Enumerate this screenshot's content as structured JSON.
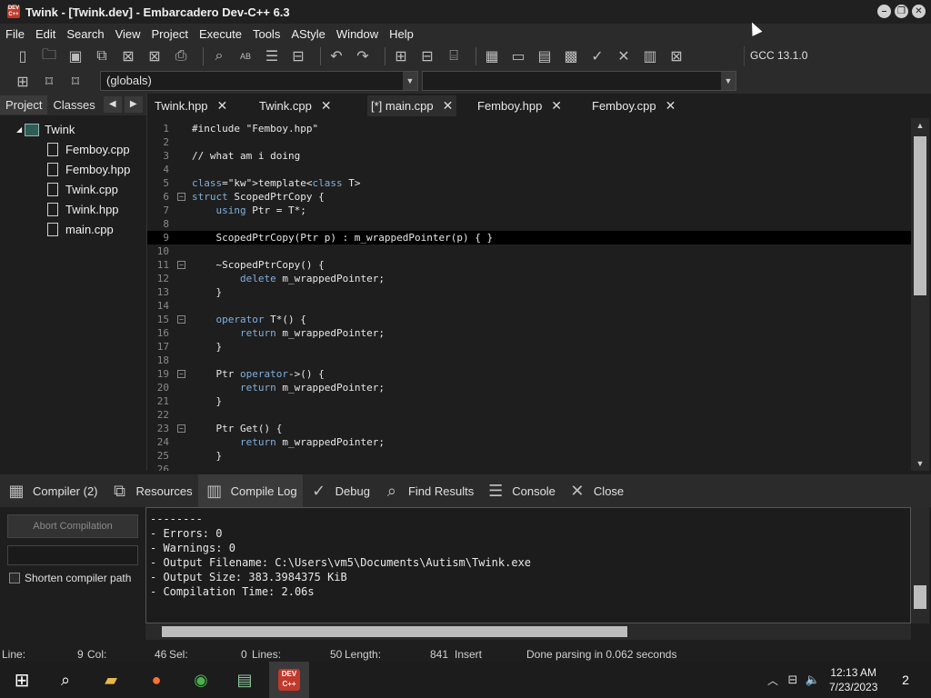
{
  "window": {
    "title": "Twink - [Twink.dev] - Embarcadero Dev-C++ 6.3",
    "app_icon_text": "DEV C++"
  },
  "menu": [
    "File",
    "Edit",
    "Search",
    "View",
    "Project",
    "Execute",
    "Tools",
    "AStyle",
    "Window",
    "Help"
  ],
  "compiler_box": "GCC 13.1.0",
  "scope_combo": "(globals)",
  "left_panel": {
    "tabs": [
      "Project",
      "Classes"
    ],
    "project_name": "Twink",
    "files": [
      "Femboy.cpp",
      "Femboy.hpp",
      "Twink.cpp",
      "Twink.hpp",
      "main.cpp"
    ]
  },
  "editor_tabs": [
    "Twink.hpp",
    "Twink.cpp",
    "[*] main.cpp",
    "Femboy.hpp",
    "Femboy.cpp"
  ],
  "code_lines": [
    {
      "n": "1",
      "t": "#include \"Femboy.hpp\""
    },
    {
      "n": "2",
      "t": ""
    },
    {
      "n": "3",
      "t": "// what am i doing"
    },
    {
      "n": "4",
      "t": ""
    },
    {
      "n": "5",
      "t": "template<class T>"
    },
    {
      "n": "6",
      "t": "struct ScopedPtrCopy {"
    },
    {
      "n": "7",
      "t": "    using Ptr = T*;"
    },
    {
      "n": "8",
      "t": ""
    },
    {
      "n": "9",
      "t": "    ScopedPtrCopy(Ptr p) : m_wrappedPointer(p) { }"
    },
    {
      "n": "10",
      "t": ""
    },
    {
      "n": "11",
      "t": "    ~ScopedPtrCopy() {"
    },
    {
      "n": "12",
      "t": "        delete m_wrappedPointer;"
    },
    {
      "n": "13",
      "t": "    }"
    },
    {
      "n": "14",
      "t": ""
    },
    {
      "n": "15",
      "t": "    operator T*() {"
    },
    {
      "n": "16",
      "t": "        return m_wrappedPointer;"
    },
    {
      "n": "17",
      "t": "    }"
    },
    {
      "n": "18",
      "t": ""
    },
    {
      "n": "19",
      "t": "    Ptr operator->() {"
    },
    {
      "n": "20",
      "t": "        return m_wrappedPointer;"
    },
    {
      "n": "21",
      "t": "    }"
    },
    {
      "n": "22",
      "t": ""
    },
    {
      "n": "23",
      "t": "    Ptr Get() {"
    },
    {
      "n": "24",
      "t": "        return m_wrappedPointer;"
    },
    {
      "n": "25",
      "t": "    }"
    },
    {
      "n": "26",
      "t": ""
    }
  ],
  "bottom_tabs": [
    "Compiler (2)",
    "Resources",
    "Compile Log",
    "Debug",
    "Find Results",
    "Console",
    "Close"
  ],
  "abort_label": "Abort Compilation",
  "shorten_label": "Shorten compiler path",
  "log_lines": [
    "--------",
    "- Errors: 0",
    "- Warnings: 0",
    "- Output Filename: C:\\Users\\vm5\\Documents\\Autism\\Twink.exe",
    "- Output Size: 383.3984375 KiB",
    "- Compilation Time: 2.06s"
  ],
  "status": {
    "line_label": "Line:",
    "line_value": "9",
    "col_label": "Col:",
    "col_value": "46",
    "sel_label": "Sel:",
    "sel_value": "0",
    "lines_label": "Lines:",
    "lines_value": "50",
    "length_label": "Length:",
    "length_value": "841",
    "mode": "Insert",
    "message": "Done parsing in 0.062 seconds"
  },
  "taskbar": {
    "time": "12:13 AM",
    "date": "7/23/2023",
    "notifications": "2"
  }
}
